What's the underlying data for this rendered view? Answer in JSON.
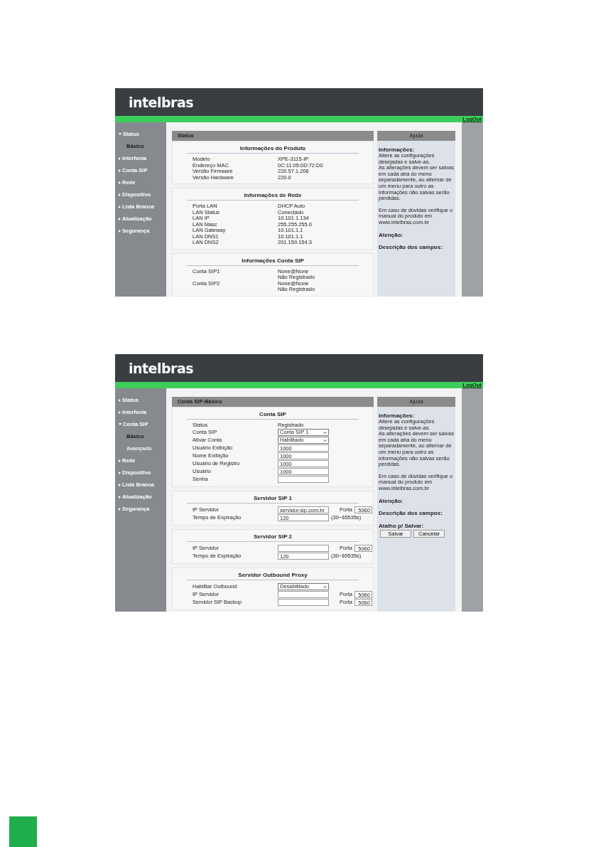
{
  "screens": [
    {
      "logo": "intelbras",
      "logout": "LogOut",
      "sidebar": [
        {
          "label": "Status",
          "expanded": true,
          "children": [
            {
              "label": "Básico",
              "selected": true
            }
          ]
        },
        {
          "label": "Interfonia",
          "expanded": false
        },
        {
          "label": "Conta SIP",
          "expanded": false
        },
        {
          "label": "Rede",
          "expanded": false
        },
        {
          "label": "Dispositivo",
          "expanded": false
        },
        {
          "label": "Lista Branca",
          "expanded": false
        },
        {
          "label": "Atualização",
          "expanded": false
        },
        {
          "label": "Segurança",
          "expanded": false
        }
      ],
      "panel_title": "Status",
      "sections": [
        {
          "title": "Informações do Produto",
          "rows": [
            {
              "kind": "text",
              "label": "Modelo",
              "value": "XPE-3115-IP"
            },
            {
              "kind": "text",
              "label": "Endereço MAC",
              "value": "0C:11:05:0D:72:D0"
            },
            {
              "kind": "text",
              "label": "Versão Firmware",
              "value": "220.57.1.206"
            },
            {
              "kind": "text",
              "label": "Versão Hardware",
              "value": "220.0"
            }
          ]
        },
        {
          "title": "Informações de Rede",
          "rows": [
            {
              "kind": "text",
              "label": "Porta LAN",
              "value": "DHCP Auto"
            },
            {
              "kind": "text",
              "label": "LAN Status",
              "value": "Conectado"
            },
            {
              "kind": "text",
              "label": "LAN IP",
              "value": "10.101.1.134"
            },
            {
              "kind": "text",
              "label": "LAN Masc",
              "value": "255.255.255.0"
            },
            {
              "kind": "text",
              "label": "LAN Gateway",
              "value": "10.101.1.1"
            },
            {
              "kind": "text",
              "label": "LAN DNS1",
              "value": "10.101.1.1"
            },
            {
              "kind": "text",
              "label": "LAN DNS2",
              "value": "201.159.154.3"
            }
          ]
        },
        {
          "title": "Informações Conta SIP",
          "rows": [
            {
              "kind": "text",
              "label": "Conta SIP1",
              "value": "None@None"
            },
            {
              "kind": "text",
              "value": "Não Registrado"
            },
            {
              "kind": "text",
              "label": "Conta SIP2",
              "value": "None@None"
            },
            {
              "kind": "text",
              "value": "Não Registrado"
            }
          ]
        }
      ],
      "help": {
        "title": "Ajuda",
        "heading": "Informações:",
        "paragraphs": [
          "Altere as configurações desejadas e salve-as.",
          "As alterações devem ser salvas em cada aba do menu separadamente, ao alternar de um menu para outro as informações não salvas serão perdidas.",
          "Em caso de dúvidas verifique o manual do produto em www.intelbras.com.br"
        ],
        "attention": "Atenção:",
        "fields": "Descrição dos campos:"
      }
    },
    {
      "logo": "intelbras",
      "logout": "LogOut",
      "sidebar": [
        {
          "label": "Status",
          "expanded": false
        },
        {
          "label": "Interfonia",
          "expanded": false
        },
        {
          "label": "Conta SIP",
          "expanded": true,
          "children": [
            {
              "label": "Básico",
              "selected": true
            },
            {
              "label": "Avançado",
              "selected": false
            }
          ]
        },
        {
          "label": "Rede",
          "expanded": false
        },
        {
          "label": "Dispositivo",
          "expanded": false
        },
        {
          "label": "Lista Branca",
          "expanded": false
        },
        {
          "label": "Atualização",
          "expanded": false
        },
        {
          "label": "Segurança",
          "expanded": false
        }
      ],
      "panel_title": "Conta SIP-Básico",
      "sections": [
        {
          "title": "Conta SIP",
          "rows": [
            {
              "kind": "text",
              "label": "Status",
              "value": "Registrado"
            },
            {
              "kind": "select",
              "label": "Conta SIP",
              "value": "Conta SIP 1"
            },
            {
              "kind": "select",
              "label": "Ativar Conta",
              "value": "Habilitado"
            },
            {
              "kind": "input",
              "label": "Usuário Exibição",
              "value": "1000"
            },
            {
              "kind": "input",
              "label": "Nome Exibição",
              "value": "1000"
            },
            {
              "kind": "input",
              "label": "Usuário de Registro",
              "value": "1000"
            },
            {
              "kind": "input",
              "label": "Usuário",
              "value": "1000"
            },
            {
              "kind": "input",
              "label": "Senha"
            }
          ]
        },
        {
          "title": "Servidor SIP 1",
          "rows": [
            {
              "kind": "input",
              "label": "IP Servidor",
              "value": "servidor.sip.com.br",
              "port_label": "Porta",
              "port_value": "5060"
            },
            {
              "kind": "input",
              "label": "Tempo de Expiração",
              "value": "120",
              "hint": "(30~65535s)"
            }
          ]
        },
        {
          "title": "Servidor SIP 2",
          "rows": [
            {
              "kind": "input",
              "label": "IP Servidor",
              "port_label": "Porta",
              "port_value": "5060"
            },
            {
              "kind": "input",
              "label": "Tempo de Expiração",
              "value": "120",
              "hint": "(30~65535s)"
            }
          ]
        },
        {
          "title": "Servidor Outbound Proxy",
          "rows": [
            {
              "kind": "select",
              "label": "Habilitar Outbound",
              "value": "Desabilitado"
            },
            {
              "kind": "input",
              "label": "IP Servidor",
              "port_label": "Porta",
              "port_value": "5060"
            },
            {
              "kind": "input",
              "label": "Servidor SIP Backup",
              "port_label": "Porta",
              "port_value": "5060"
            }
          ]
        }
      ],
      "help": {
        "title": "Ajuda",
        "heading": "Informações:",
        "paragraphs": [
          "Altere as configurações desejadas e salve-as.",
          "As alterações devem ser salvas em cada aba do menu separadamente, ao alternar de um menu para outro as informações não salvas serão perdidas.",
          "Em caso de dúvidas verifique o manual do produto em www.intelbras.com.br"
        ],
        "attention": "Atenção:",
        "fields": "Descrição dos campos:",
        "shortcut": {
          "title": "Atalho p/ Salvar:",
          "buttons": [
            "Salvar",
            "Cancelar"
          ]
        }
      }
    }
  ]
}
